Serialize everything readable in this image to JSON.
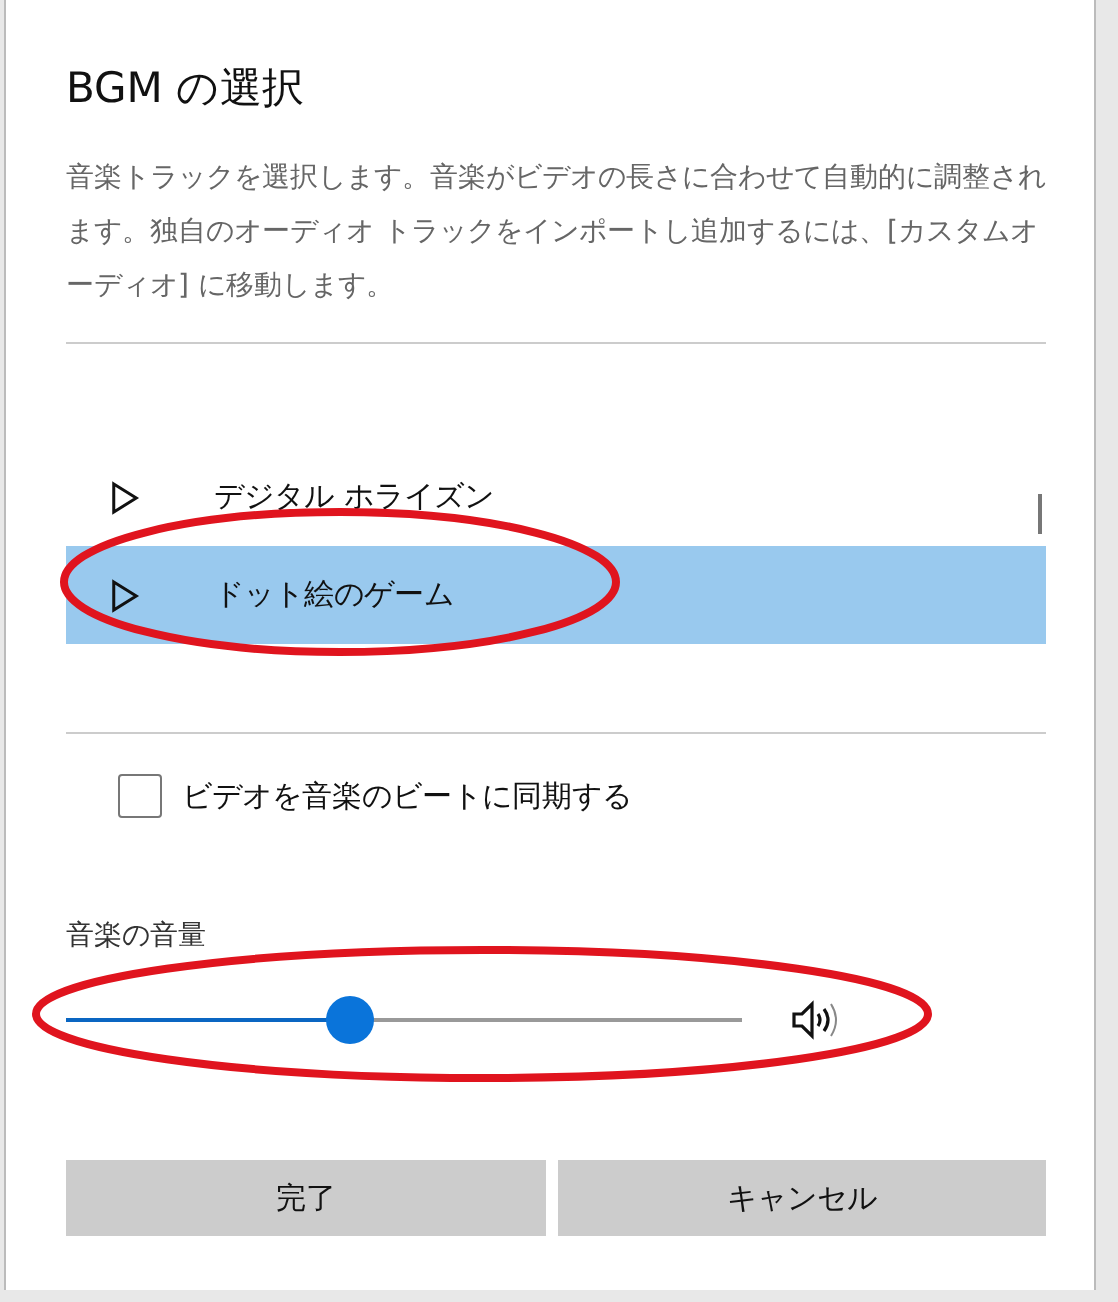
{
  "dialog": {
    "title": "BGM の選択",
    "description": "音楽トラックを選択します。音楽がビデオの長さに合わせて自動的に調整されます。独自のオーディオ トラックをインポートし追加するには、[カスタムオーディオ] に移動します。"
  },
  "tracks": [
    {
      "name": "デジタル ホライズン",
      "selected": false
    },
    {
      "name": "ドット絵のゲーム",
      "selected": true
    }
  ],
  "sync_checkbox": {
    "label": "ビデオを音楽のビートに同期する",
    "checked": false
  },
  "volume": {
    "label": "音楽の音量",
    "level": 0.42
  },
  "buttons": [
    {
      "label": "完了"
    },
    {
      "label": "キャンセル"
    }
  ],
  "annotations": [
    {
      "color": "#e0141e"
    },
    {
      "color": "#e0141e"
    }
  ]
}
